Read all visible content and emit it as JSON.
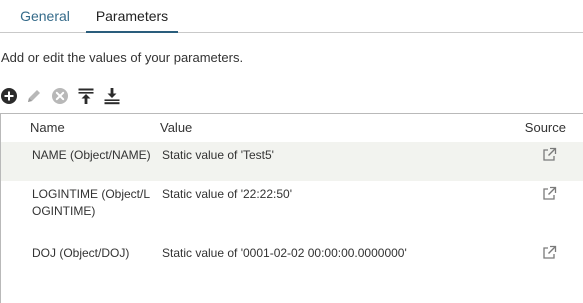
{
  "tabs": [
    {
      "label": "General",
      "active": false
    },
    {
      "label": "Parameters",
      "active": true
    }
  ],
  "description": "Add or edit the values of your parameters.",
  "toolbar": {
    "buttons": [
      {
        "icon": "add-icon",
        "enabled": true
      },
      {
        "icon": "edit-icon",
        "enabled": false
      },
      {
        "icon": "remove-icon",
        "enabled": false
      },
      {
        "icon": "move-to-top-icon",
        "enabled": true
      },
      {
        "icon": "move-to-bottom-icon",
        "enabled": true
      }
    ]
  },
  "table": {
    "columns": [
      "Name",
      "Value",
      "Source"
    ],
    "rows": [
      {
        "name": "NAME (Object/NAME)",
        "value": "Static value of 'Test5'",
        "source_icon": "external-link-icon"
      },
      {
        "name": "LOGINTIME (Object/LOGINTIME)",
        "value": "Static value of '22:22:50'",
        "source_icon": "external-link-icon"
      },
      {
        "name": "DOJ (Object/DOJ)",
        "value": "Static value of '0001-02-02 00:00:00.0000000'",
        "source_icon": "external-link-icon"
      }
    ]
  },
  "colors": {
    "active_tab_underline": "#2a5d7c",
    "inactive_tab_text": "#356b8a",
    "selected_row_bg": "#f2f3ef"
  }
}
